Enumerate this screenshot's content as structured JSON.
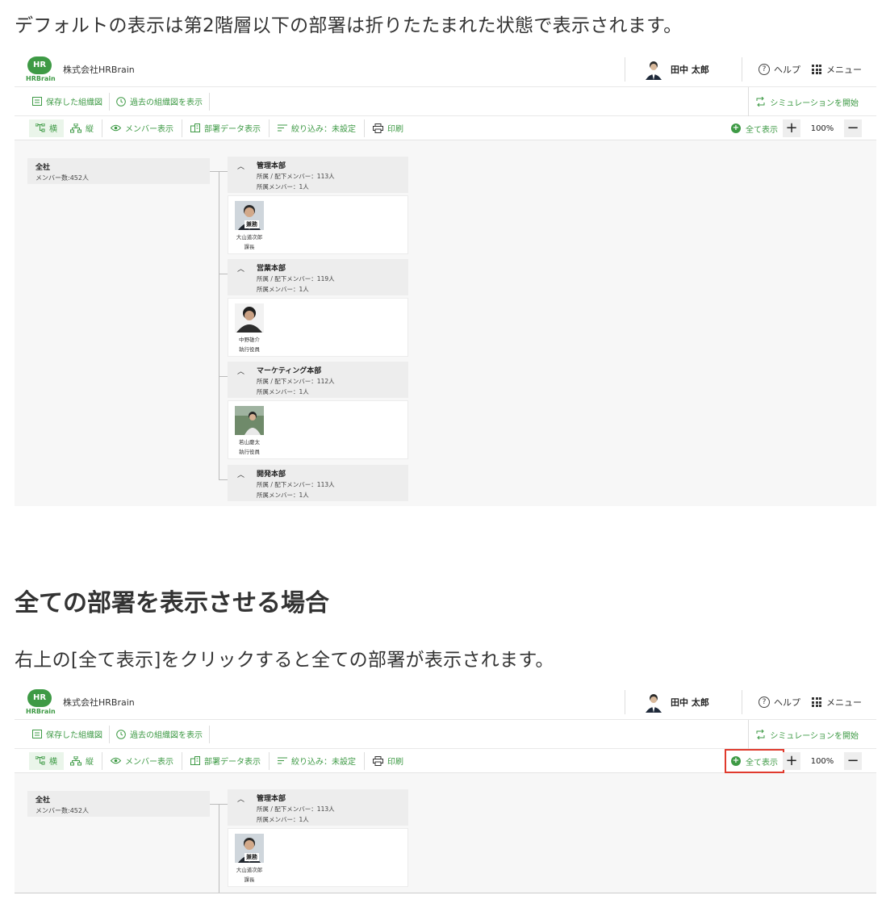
{
  "article": {
    "para1": "デフォルトの表示は第2階層以下の部署は折りたたまれた状態で表示されます。",
    "heading": "全ての部署を表示させる場合",
    "para2": "右上の[全て表示]をクリックすると全ての部署が表示されます。"
  },
  "app": {
    "logo_text": "HR",
    "logo_sub": "HRBrain",
    "company": "株式会社HRBrain",
    "user_name": "田中 太郎",
    "help": "ヘルプ",
    "menu": "メニュー",
    "saved_charts": "保存した組織図",
    "past_charts": "過去の組織図を表示",
    "start_simulation": "シミュレーションを開始",
    "toolbar": {
      "horizontal": "横",
      "vertical": "縦",
      "show_members": "メンバー表示",
      "dept_data": "部署データ表示",
      "filter": "絞り込み：未設定",
      "print": "印刷",
      "show_all": "全て表示",
      "zoom": "100%"
    },
    "colors": {
      "accent": "#3e9a45",
      "highlight": "#e03a2d"
    }
  },
  "org": {
    "root": {
      "name": "全社",
      "count": "メンバー数:452人"
    },
    "departments": [
      {
        "name": "管理本部",
        "sub_members": "所属 / 配下メンバー：113人",
        "members": "所属メンバー：1人",
        "person": {
          "name": "大山道次郎",
          "role": "課長",
          "tag": "兼務"
        }
      },
      {
        "name": "営業本部",
        "sub_members": "所属 / 配下メンバー：119人",
        "members": "所属メンバー：1人",
        "person": {
          "name": "中野雄介",
          "role": "執行役員"
        }
      },
      {
        "name": "マーケティング本部",
        "sub_members": "所属 / 配下メンバー：112人",
        "members": "所属メンバー：1人",
        "person": {
          "name": "若山慶太",
          "role": "執行役員"
        }
      },
      {
        "name": "開発本部",
        "sub_members": "所属 / 配下メンバー：113人",
        "members": "所属メンバー：1人"
      }
    ]
  }
}
